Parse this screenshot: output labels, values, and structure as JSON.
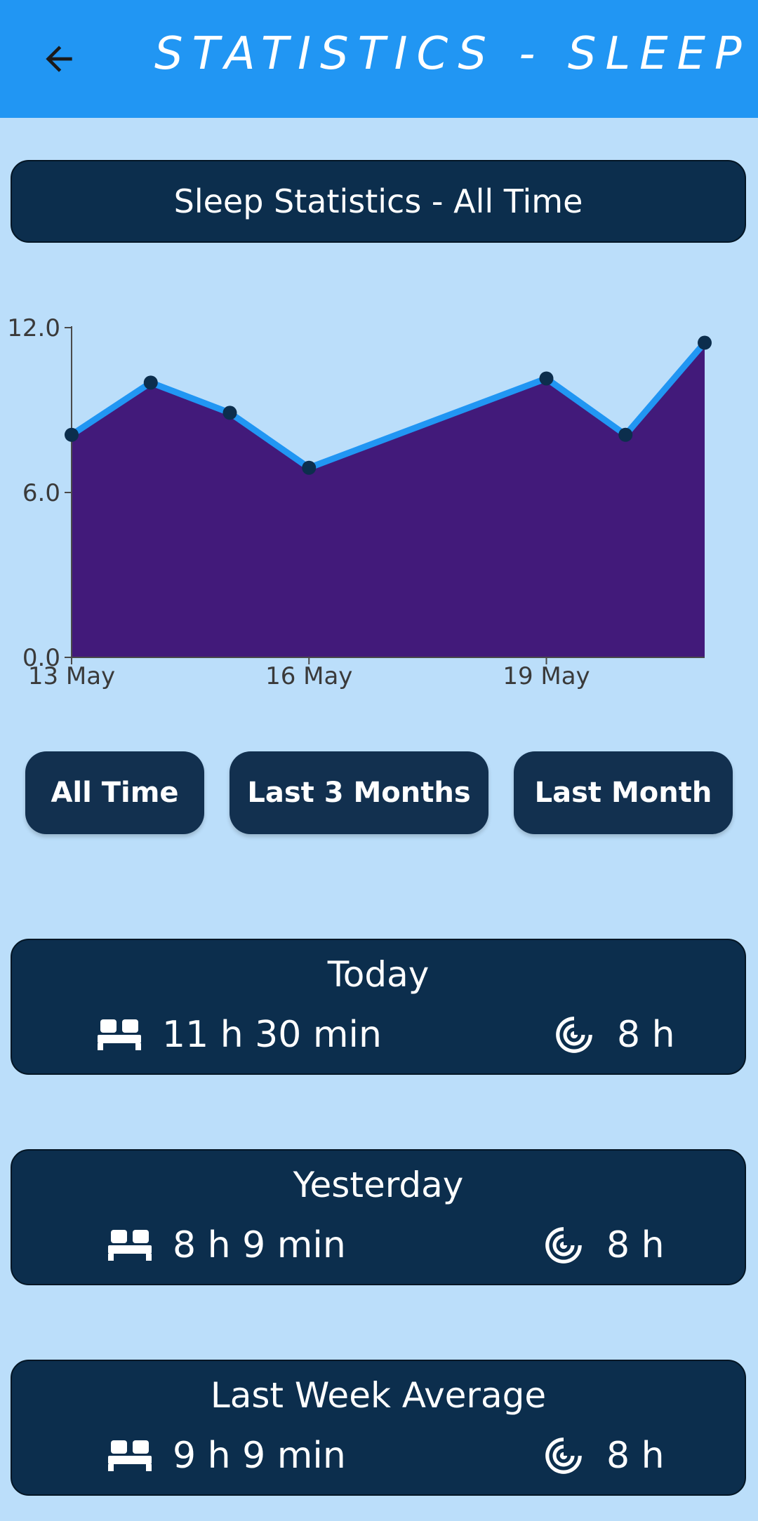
{
  "app_bar": {
    "title": "STATISTICS - SLEEP",
    "back_icon": "arrow-left-icon",
    "color": "#2196f3"
  },
  "header_card": {
    "label": "Sleep Statistics - All Time"
  },
  "chart_data": {
    "type": "area",
    "x": [
      "13 May",
      "14 May",
      "15 May",
      "16 May",
      "19 May",
      "20 May",
      "21 May"
    ],
    "values": [
      8.1,
      10.0,
      8.9,
      6.9,
      10.15,
      8.1,
      11.45
    ],
    "ylim": [
      0,
      12
    ],
    "yticks": [
      "0.0",
      "6.0",
      "12.0"
    ],
    "xticks": [
      "13 May",
      "16 May",
      "19 May"
    ],
    "line_color": "#2196f3",
    "fill_color": "#421a7a",
    "point_color": "#0c2e4d",
    "grid": false
  },
  "range_buttons": [
    {
      "label": "All Time"
    },
    {
      "label": "Last 3 Months"
    },
    {
      "label": "Last Month"
    }
  ],
  "stats": [
    {
      "title": "Today",
      "sleep": "11 h 30 min",
      "goal": "8 h"
    },
    {
      "title": "Yesterday",
      "sleep": "8 h 9 min",
      "goal": "8 h"
    },
    {
      "title": "Last Week Average",
      "sleep": "9 h 9 min",
      "goal": "8 h"
    }
  ],
  "icons": {
    "sleep": "bed-icon",
    "goal": "target-icon"
  }
}
